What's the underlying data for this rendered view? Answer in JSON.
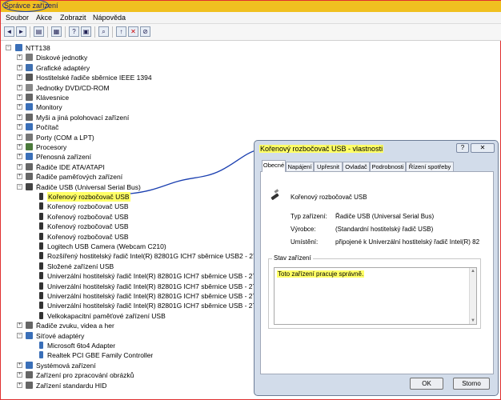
{
  "window": {
    "title": "Správce zařízení"
  },
  "menu": [
    "Soubor",
    "Akce",
    "Zobrazit",
    "Nápověda"
  ],
  "toolbar_icons": [
    "back-icon",
    "forward-icon",
    "properties-icon",
    "tree-icon",
    "help-icon",
    "view-icon",
    "scan-icon",
    "update-driver-icon",
    "uninstall-icon",
    "disable-icon"
  ],
  "tree": {
    "root": "NTT138",
    "items": [
      {
        "label": "Diskové jednotky",
        "level": 1,
        "exp": "+",
        "icon": "#7a7a7a"
      },
      {
        "label": "Grafické adaptéry",
        "level": 1,
        "exp": "+",
        "icon": "#3f6fb0"
      },
      {
        "label": "Hostitelské řadiče sběrnice IEEE 1394",
        "level": 1,
        "exp": "+",
        "icon": "#555"
      },
      {
        "label": "Jednotky DVD/CD-ROM",
        "level": 1,
        "exp": "+",
        "icon": "#888"
      },
      {
        "label": "Klávesnice",
        "level": 1,
        "exp": "+",
        "icon": "#666"
      },
      {
        "label": "Monitory",
        "level": 1,
        "exp": "+",
        "icon": "#3a6fb8"
      },
      {
        "label": "Myši a jiná polohovací zařízení",
        "level": 1,
        "exp": "+",
        "icon": "#666"
      },
      {
        "label": "Počítač",
        "level": 1,
        "exp": "+",
        "icon": "#3a6fb8"
      },
      {
        "label": "Porty (COM a LPT)",
        "level": 1,
        "exp": "+",
        "icon": "#777"
      },
      {
        "label": "Procesory",
        "level": 1,
        "exp": "+",
        "icon": "#4b7a3b"
      },
      {
        "label": "Přenosná zařízení",
        "level": 1,
        "exp": "+",
        "icon": "#3a6fb8"
      },
      {
        "label": "Řadiče IDE ATA/ATAPI",
        "level": 1,
        "exp": "+",
        "icon": "#666"
      },
      {
        "label": "Řadiče paměťových zařízení",
        "level": 1,
        "exp": "+",
        "icon": "#666"
      },
      {
        "label": "Řadiče USB (Universal Serial Bus)",
        "level": 1,
        "exp": "−",
        "icon": "#444"
      },
      {
        "label": "Kořenový rozbočovač USB",
        "level": 2,
        "icon": "#333",
        "highlight": true
      },
      {
        "label": "Kořenový rozbočovač USB",
        "level": 2,
        "icon": "#333"
      },
      {
        "label": "Kořenový rozbočovač USB",
        "level": 2,
        "icon": "#333"
      },
      {
        "label": "Kořenový rozbočovač USB",
        "level": 2,
        "icon": "#333"
      },
      {
        "label": "Kořenový rozbočovač USB",
        "level": 2,
        "icon": "#333"
      },
      {
        "label": "Logitech USB Camera (Webcam C210)",
        "level": 2,
        "icon": "#333"
      },
      {
        "label": "Rozšířený hostitelský řadič Intel(R) 82801G ICH7 sběrnice USB2 - 27CC",
        "level": 2,
        "icon": "#333"
      },
      {
        "label": "Složené zařízení USB",
        "level": 2,
        "icon": "#333"
      },
      {
        "label": "Univerzální hostitelský řadič Intel(R) 82801G ICH7 sběrnice USB - 27C8",
        "level": 2,
        "icon": "#333"
      },
      {
        "label": "Univerzální hostitelský řadič Intel(R) 82801G ICH7 sběrnice USB - 27C9",
        "level": 2,
        "icon": "#333"
      },
      {
        "label": "Univerzální hostitelský řadič Intel(R) 82801G ICH7 sběrnice USB - 27CA",
        "level": 2,
        "icon": "#333"
      },
      {
        "label": "Univerzální hostitelský řadič Intel(R) 82801G ICH7 sběrnice USB - 27CB",
        "level": 2,
        "icon": "#333"
      },
      {
        "label": "Velkokapacitní paměťové zařízení USB",
        "level": 2,
        "icon": "#333"
      },
      {
        "label": "Řadiče zvuku, videa a her",
        "level": 1,
        "exp": "+",
        "icon": "#666"
      },
      {
        "label": "Síťové adaptéry",
        "level": 1,
        "exp": "−",
        "icon": "#3a6fb8"
      },
      {
        "label": "Microsoft 6to4 Adapter",
        "level": 2,
        "icon": "#3a6fb8"
      },
      {
        "label": "Realtek PCI GBE Family Controller",
        "level": 2,
        "icon": "#3a6fb8"
      },
      {
        "label": "Systémová zařízení",
        "level": 1,
        "exp": "+",
        "icon": "#3a6fb8"
      },
      {
        "label": "Zařízení pro zpracování obrázků",
        "level": 1,
        "exp": "+",
        "icon": "#666"
      },
      {
        "label": "Zařízení standardu HID",
        "level": 1,
        "exp": "+",
        "icon": "#666"
      }
    ]
  },
  "dialog": {
    "title": "Kořenový rozbočovač USB - vlastnosti",
    "help_btn": "?",
    "close_btn": "✕",
    "tabs": [
      "Obecné",
      "Napájení",
      "Upřesnit",
      "Ovladač",
      "Podrobnosti",
      "Řízení spotřeby"
    ],
    "device_name": "Kořenový rozbočovač USB",
    "props": [
      {
        "label": "Typ zařízení:",
        "value": "Řadiče USB (Universal Serial Bus)"
      },
      {
        "label": "Výrobce:",
        "value": "(Standardní hostitelský řadič USB)"
      },
      {
        "label": "Umístění:",
        "value": "připojené k Univerzální hostitelský řadič Intel(R) 82"
      }
    ],
    "status_group_label": "Stav zařízení",
    "status_text": "Toto zařízení pracuje správně.",
    "ok": "OK",
    "cancel": "Storno"
  },
  "colors": {
    "highlight": "#ffff66",
    "titlebar": "#f0c020",
    "annotation": "#1a3fb0"
  }
}
